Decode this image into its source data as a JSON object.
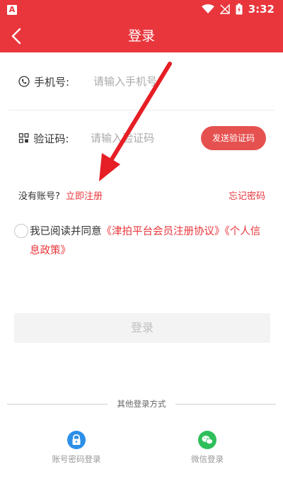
{
  "status_bar": {
    "time": "3:32",
    "app_badge": "A"
  },
  "header": {
    "title": "登录"
  },
  "form": {
    "phone": {
      "label": "手机号:",
      "placeholder": "请输入手机号"
    },
    "code": {
      "label": "验证码:",
      "placeholder": "请输入验证码",
      "send_button": "发送验证码"
    }
  },
  "links": {
    "no_account": "没有账号?",
    "register": "立即注册",
    "forgot": "忘记密码"
  },
  "agreement": {
    "prefix": "我已阅读并同意",
    "link1": "《津拍平台会员注册协议》",
    "link2": "《个人信息政策》"
  },
  "login_button": "登录",
  "other_login": {
    "title": "其他登录方式",
    "options": [
      {
        "label": "账号密码登录",
        "icon": "lock-icon",
        "color": "#2c8fe8"
      },
      {
        "label": "微信登录",
        "icon": "wechat-icon",
        "color": "#2fbf5a"
      }
    ]
  },
  "colors": {
    "brand": "#e8363c",
    "button": "#e5514f"
  }
}
